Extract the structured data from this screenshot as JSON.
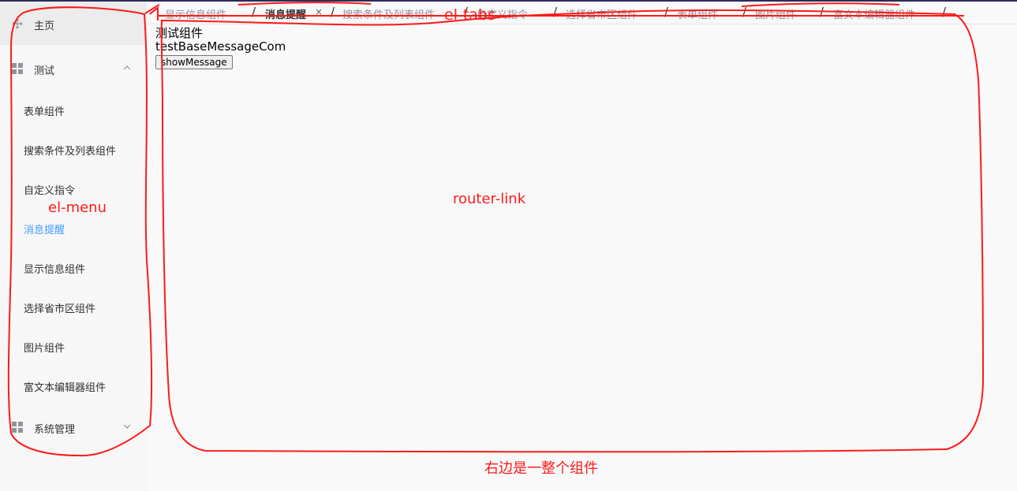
{
  "sidebar": {
    "home": {
      "label": "主页",
      "icon": "move-icon"
    },
    "test_group": {
      "label": "测试",
      "icon": "grid-icon",
      "expanded": true
    },
    "test_items": [
      {
        "label": "表单组件",
        "active": false
      },
      {
        "label": "搜索条件及列表组件",
        "active": false
      },
      {
        "label": "自定义指令",
        "active": false
      },
      {
        "label": "消息提醒",
        "active": true
      },
      {
        "label": "显示信息组件",
        "active": false
      },
      {
        "label": "选择省市区组件",
        "active": false
      },
      {
        "label": "图片组件",
        "active": false
      },
      {
        "label": "富文本编辑器组件",
        "active": false
      }
    ],
    "system_group": {
      "label": "系统管理",
      "icon": "grid-icon",
      "expanded": false
    }
  },
  "tabs": [
    {
      "label": "显示信息组件",
      "active": false
    },
    {
      "label": "消息提醒",
      "active": true,
      "closable": true
    },
    {
      "label": "搜索条件及列表组件",
      "active": false
    },
    {
      "label": "自定义指令",
      "active": false
    },
    {
      "label": "选择省市区组件",
      "active": false
    },
    {
      "label": "表单组件",
      "active": false
    },
    {
      "label": "图片组件",
      "active": false
    },
    {
      "label": "富文本编辑器组件",
      "active": false
    }
  ],
  "tab_separator": "/",
  "tab_close_glyph": "×",
  "content": {
    "title": "测试组件",
    "subtitle": "testBaseMessageCom",
    "button_label": "showMessage"
  },
  "annotations": {
    "tabs": "el-tabs",
    "menu": "el-menu",
    "router": "router-link",
    "component": "右边是一整个组件"
  },
  "colors": {
    "active_menu": "#409eff",
    "annotation": "#ff1a1a",
    "text": "#303133",
    "muted": "#909399"
  }
}
